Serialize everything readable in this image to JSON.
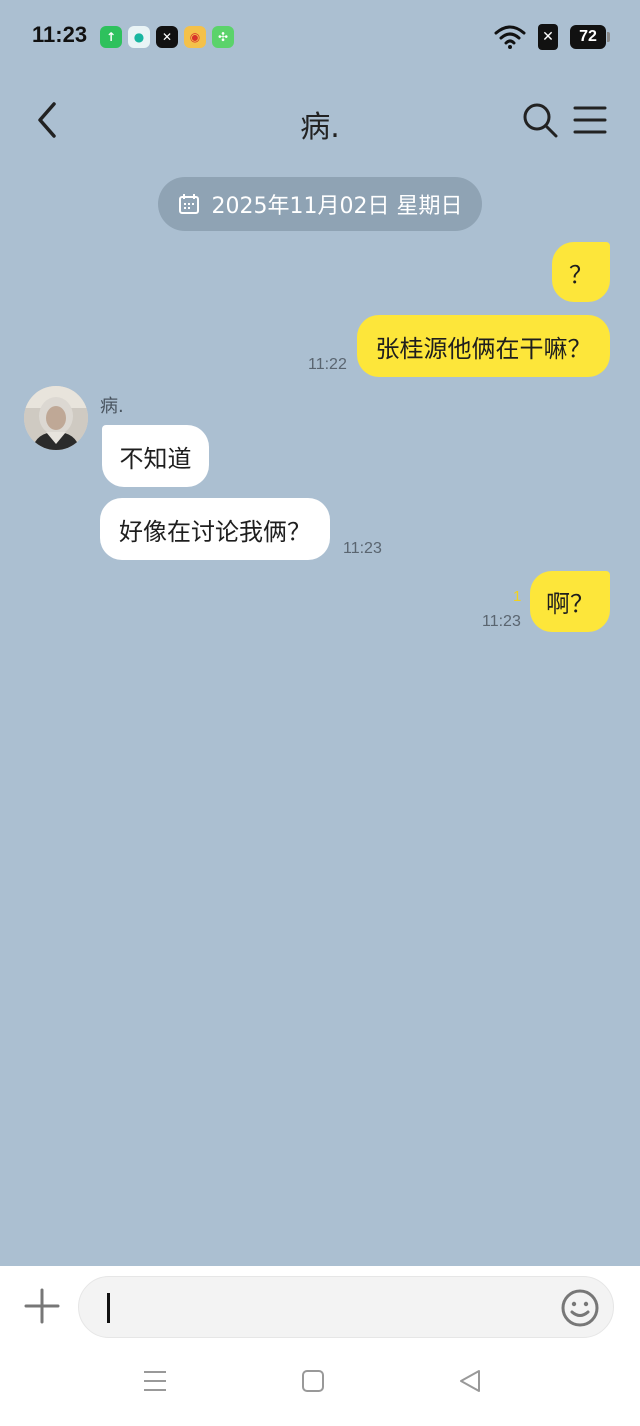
{
  "status_bar": {
    "time": "11:23",
    "battery": "72",
    "app_icons": [
      {
        "name": "upload-app-icon",
        "glyph": "↑",
        "color": "#2ec15d"
      },
      {
        "name": "drop-app-icon",
        "glyph": "●",
        "color": "#e9f4f6"
      },
      {
        "name": "capcut-app-icon",
        "glyph": "✕",
        "color": "#111111"
      },
      {
        "name": "weibo-app-icon",
        "glyph": "◉",
        "color": "#f4c14a"
      },
      {
        "name": "clover-app-icon",
        "glyph": "✣",
        "color": "#5bd36b"
      }
    ],
    "x_badge": "✕"
  },
  "header": {
    "title": "病."
  },
  "date_divider": "2025年11月02日 星期日",
  "messages": {
    "m1": {
      "text": "？"
    },
    "m2": {
      "text": "张桂源他俩在干嘛？",
      "time": "11:22"
    },
    "sender": "病.",
    "m3": {
      "text": "不知道"
    },
    "m4": {
      "text": "好像在讨论我俩？",
      "time": "11:23"
    },
    "m5": {
      "text": "啊？",
      "time": "11:23",
      "unread": "1"
    }
  },
  "colors": {
    "background": "#abbfd1",
    "my_bubble": "#fde63a",
    "their_bubble": "#ffffff",
    "date_pill": "#8fa3b4"
  }
}
